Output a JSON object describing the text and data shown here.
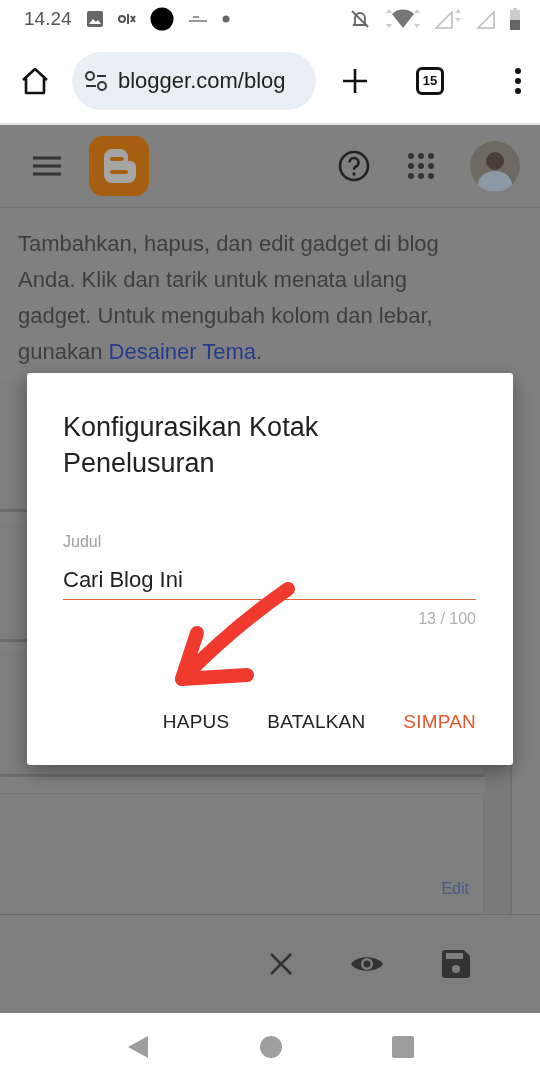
{
  "status_bar": {
    "time": "14.24"
  },
  "browser": {
    "url": "blogger.com/blog",
    "tab_count": "15"
  },
  "page": {
    "intro_text": "Tambahkan, hapus, dan edit gadget di blog Anda. Klik dan tarik untuk menata ulang gadget. Untuk mengubah kolom dan lebar, gunakan ",
    "intro_link": "Desainer Tema",
    "intro_end": ".",
    "edit_link": "Edit"
  },
  "dialog": {
    "title": "Konfigurasikan Kotak Penelusuran",
    "field_label": "Judul",
    "field_value": "Cari Blog Ini",
    "counter": "13 / 100",
    "buttons": [
      {
        "label": "HAPUS",
        "kind": "plain"
      },
      {
        "label": "BATALKAN",
        "kind": "plain"
      },
      {
        "label": "SIMPAN",
        "kind": "primary"
      }
    ]
  }
}
